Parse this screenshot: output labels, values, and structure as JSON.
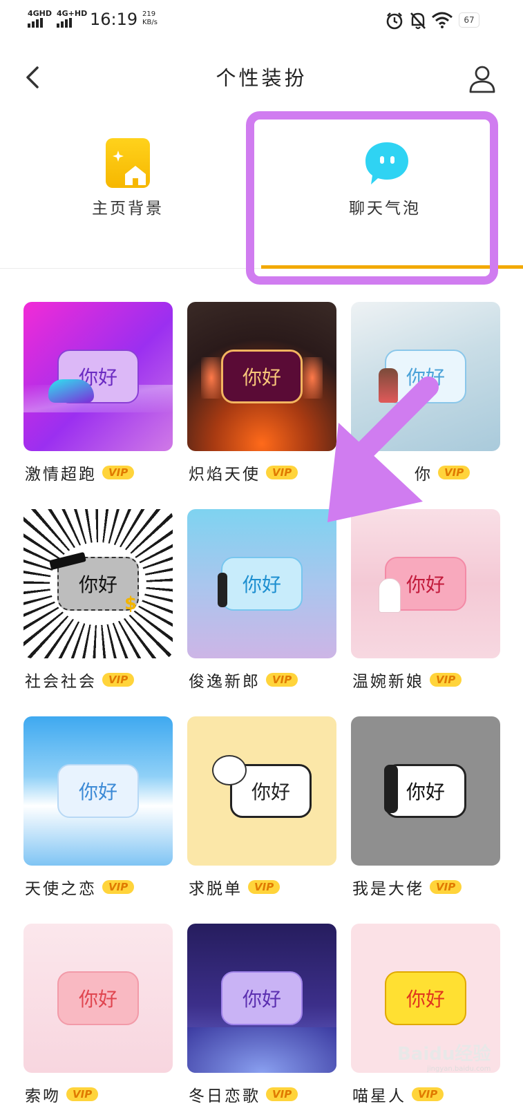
{
  "status_bar": {
    "signal1": "4GHD",
    "signal2": "4G+HD",
    "time": "16:19",
    "speed_value": "219",
    "speed_unit": "KB/s",
    "battery": "67"
  },
  "header": {
    "title": "个性装扮",
    "back_icon": "chevron-left-icon",
    "user_icon": "user-icon"
  },
  "tabs": [
    {
      "label": "主页背景",
      "icon": "home-background-icon",
      "selected": false
    },
    {
      "label": "聊天气泡",
      "icon": "chat-bubble-icon",
      "selected": true
    }
  ],
  "bubble_text": "你好",
  "vip_label": "VIP",
  "items": [
    {
      "name": "激情超跑"
    },
    {
      "name": "炽焰天使"
    },
    {
      "name": "你"
    },
    {
      "name": "社会社会"
    },
    {
      "name": "俊逸新郎"
    },
    {
      "name": "温婉新娘"
    },
    {
      "name": "天使之恋"
    },
    {
      "name": "求脱单"
    },
    {
      "name": "我是大佬"
    },
    {
      "name": "索吻"
    },
    {
      "name": "冬日恋歌"
    },
    {
      "name": "喵星人"
    }
  ],
  "watermark": {
    "logo": "Baidu经验",
    "url": "jingyan.baidu.com"
  },
  "colors": {
    "accent_underline": "#f2a900",
    "highlight": "#d07cf0",
    "vip_bg": "#ffd43b"
  }
}
